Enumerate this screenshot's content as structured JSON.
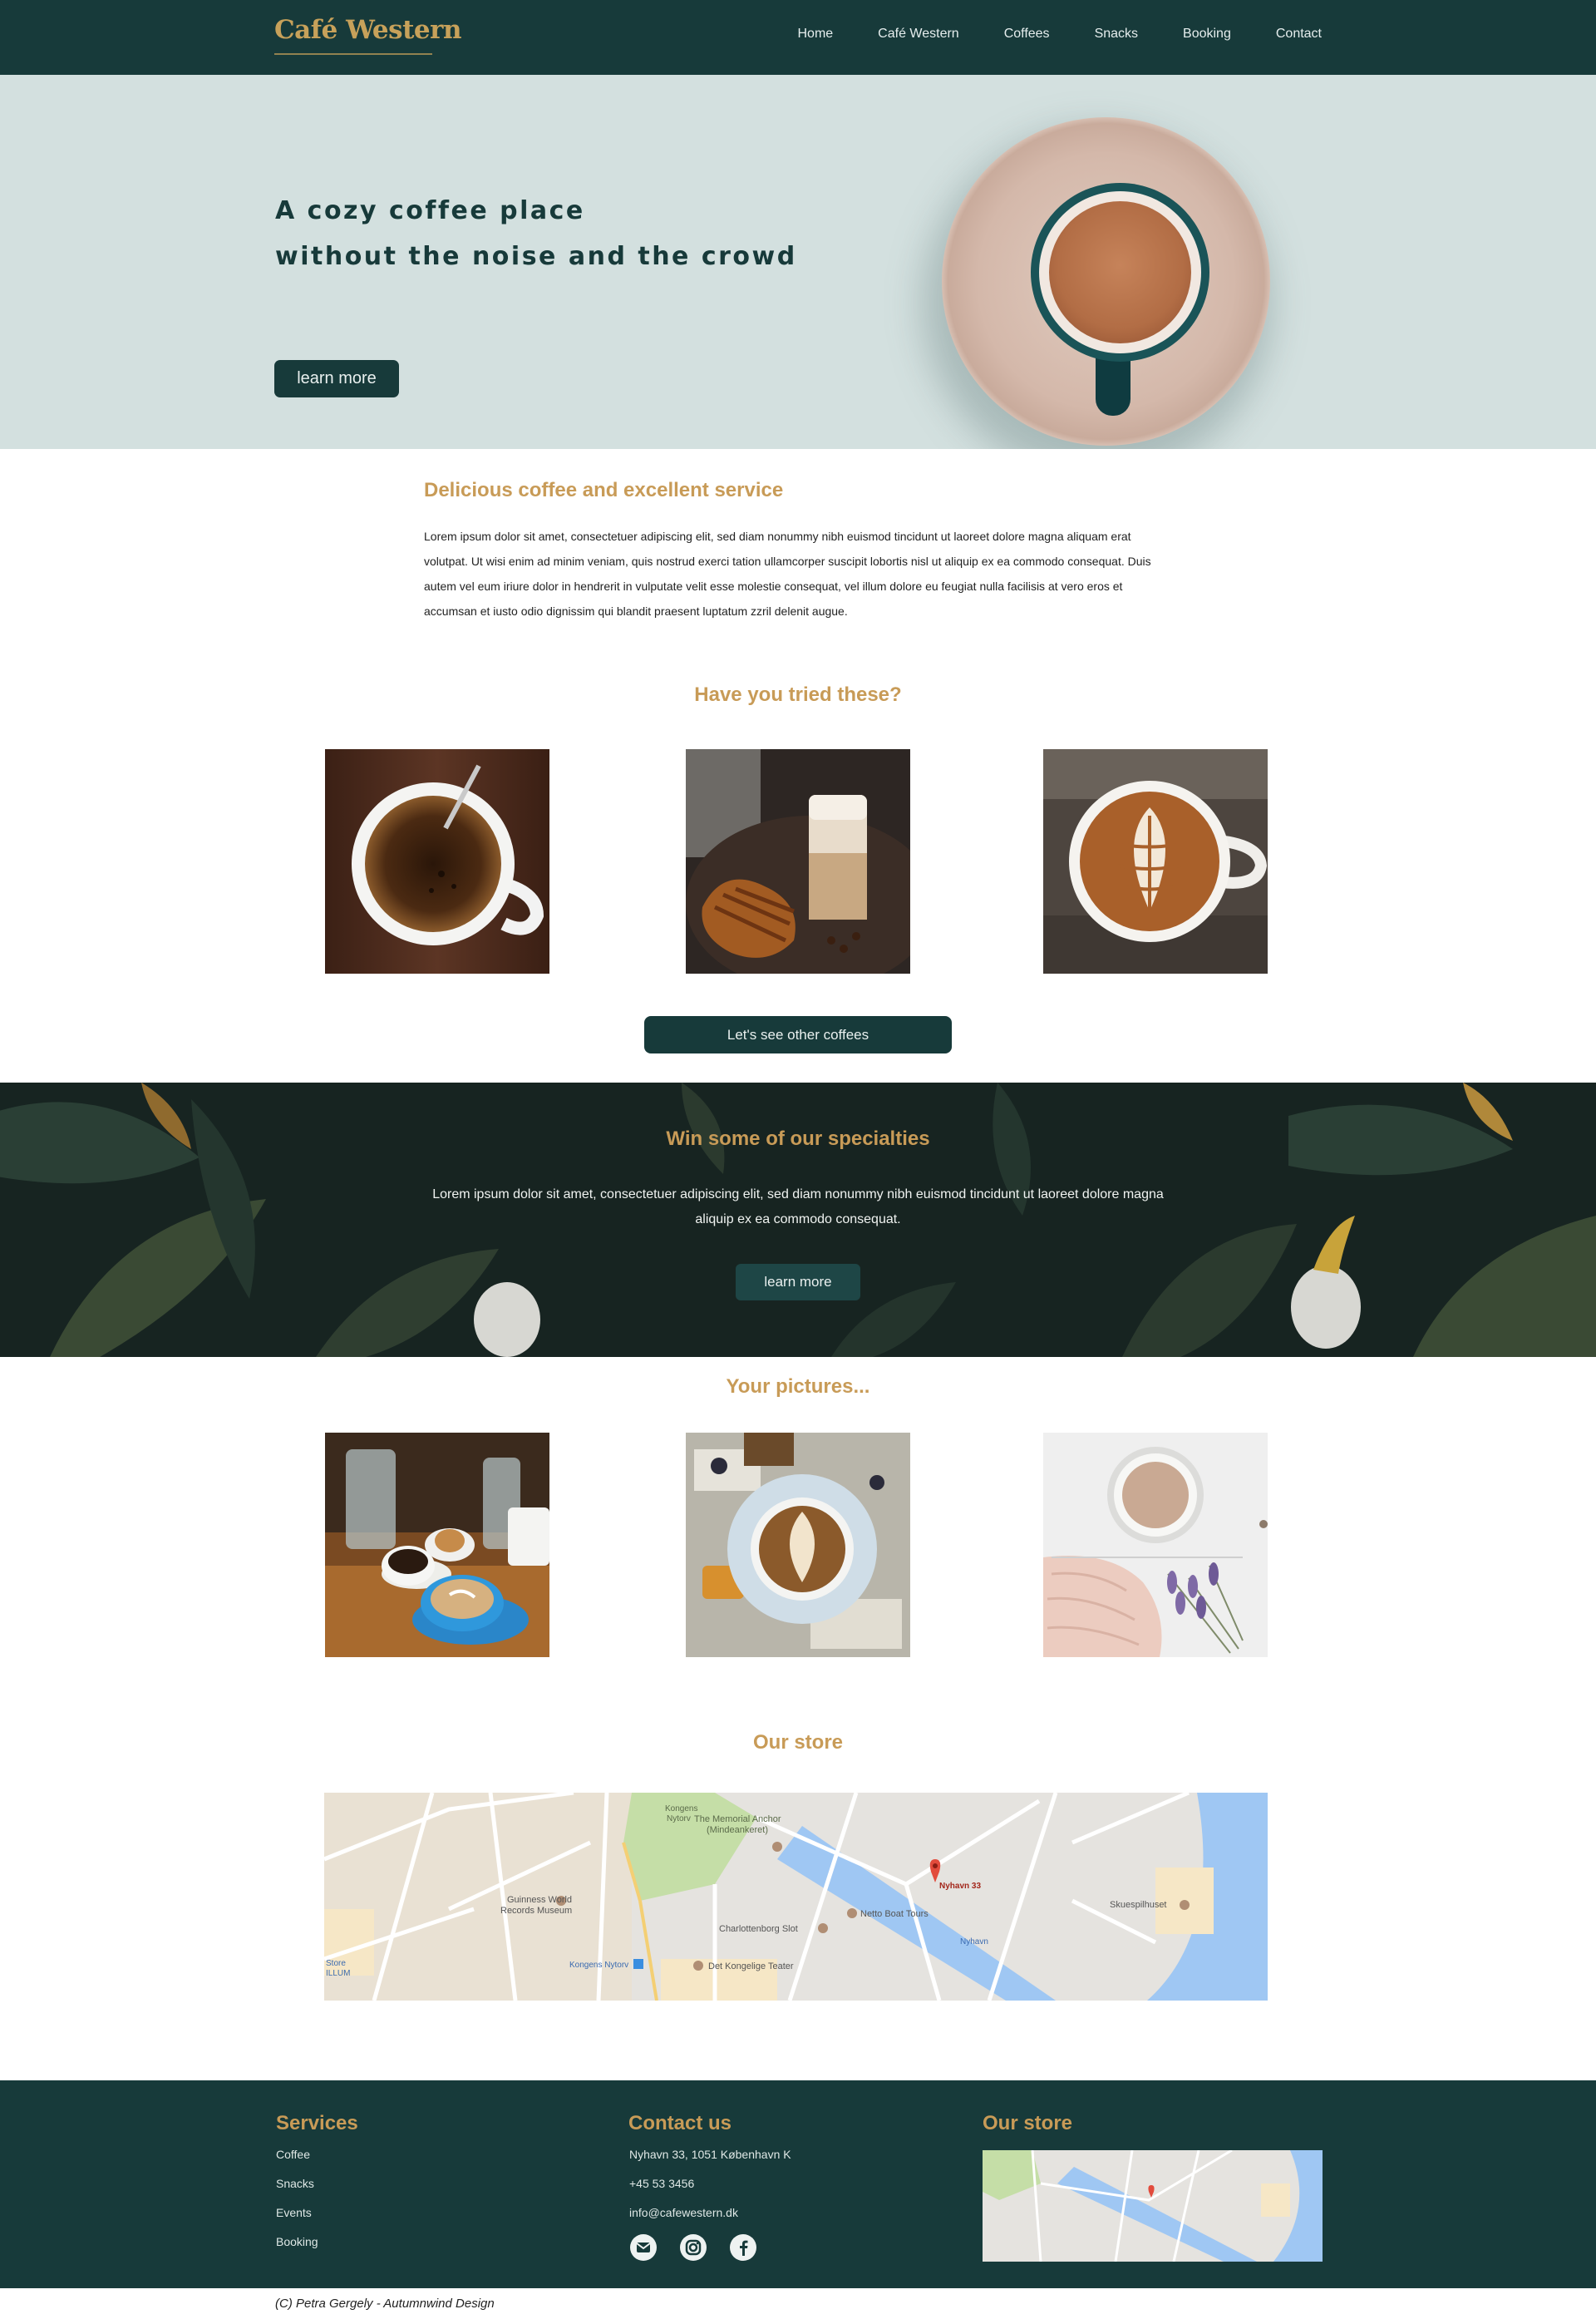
{
  "nav": {
    "logo": "Café Western",
    "items": [
      "Home",
      "Café Western",
      "Coffees",
      "Snacks",
      "Booking",
      "Contact"
    ]
  },
  "hero": {
    "title_line1": "A cozy coffee place",
    "title_line2": "without the noise and the crowd",
    "button": "learn more"
  },
  "intro": {
    "title": "Delicious coffee and excellent service",
    "text": "Lorem ipsum dolor sit amet, consectetuer adipiscing elit, sed diam nonummy nibh euismod tincidunt ut laoreet dolore magna aliquam erat volutpat. Ut wisi enim ad minim veniam, quis nostrud exerci tation ullamcorper suscipit lobortis nisl ut aliquip ex ea commodo consequat. Duis autem vel eum iriure dolor in hendrerit in vulputate velit esse molestie consequat, vel illum dolore eu feugiat nulla facilisis at vero eros et accumsan et iusto odio dignissim qui blandit praesent luptatum zzril delenit augue."
  },
  "tried": {
    "title": "Have you tried these?",
    "button": "Let's see other coffees"
  },
  "win": {
    "title": "Win some of our specialties",
    "text_line1": "Lorem ipsum dolor sit amet, consectetuer adipiscing elit, sed diam nonummy nibh euismod tincidunt ut laoreet dolore magna",
    "text_line2": "aliquip ex ea commodo consequat.",
    "button": "learn more"
  },
  "pictures": {
    "title": "Your pictures..."
  },
  "store": {
    "title": "Our store",
    "map_labels": {
      "anchor": "The Memorial Anchor",
      "anchor_sub": "(Mindeankeret)",
      "kongens": "Kongens",
      "nytorv": "Nytorv",
      "nyhavn_pin": "Nyhavn 33",
      "netto": "Netto Boat Tours",
      "charlottenborg": "Charlottenborg Slot",
      "teater": "Det Kongelige Teater",
      "guinness1": "Guinness World",
      "guinness2": "Records Museum",
      "skuespil": "Skuespilhuset",
      "metro": "Kongens Nytorv",
      "nyhavn_st": "Nyhavn",
      "store_label": "Store",
      "illum": "ILLUM"
    }
  },
  "footer": {
    "services_title": "Services",
    "services": [
      "Coffee",
      "Snacks",
      "Events",
      "Booking"
    ],
    "contact_title": "Contact us",
    "address": "Nyhavn 33, 1051 København K",
    "phone": "+45 53 3456",
    "email": "info@cafewestern.dk",
    "store_title": "Our store",
    "social_icons": [
      "mail-icon",
      "instagram-icon",
      "facebook-icon"
    ],
    "copyright": "(C) Petra Gergely - Autumnwind Design"
  },
  "colors": {
    "primary": "#173a3a",
    "accent": "#c89b57",
    "hero_bg": "#d3e0df"
  }
}
